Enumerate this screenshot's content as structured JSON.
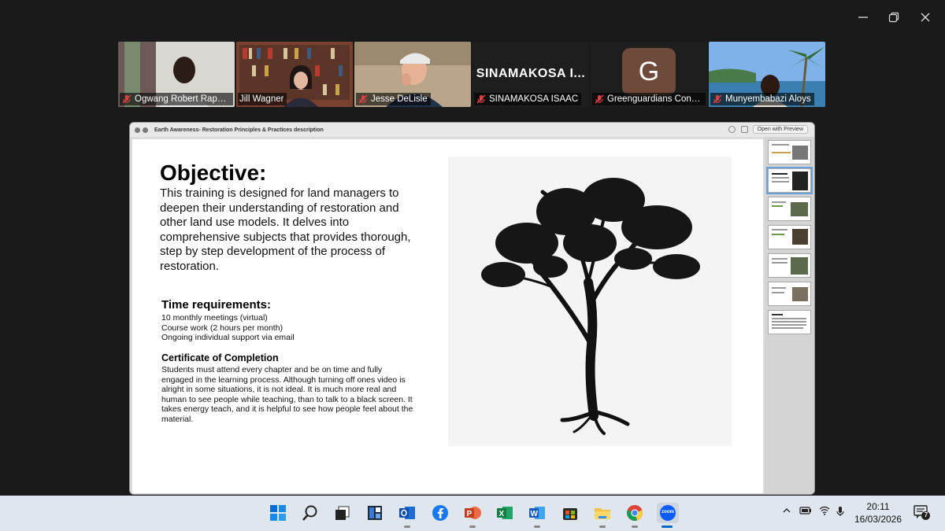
{
  "participants": [
    {
      "name": "Ogwang Robert Rapsy...",
      "muted": true
    },
    {
      "name": "Jill Wagner",
      "muted": false,
      "active_speaker": true
    },
    {
      "name": "Jesse DeLisle",
      "muted": true
    },
    {
      "name": "SINAMAKOSA ISAAC",
      "muted": true,
      "display_title": "SINAMAKOSA  I..."
    },
    {
      "name": "Greenguardians Cons...",
      "muted": true,
      "avatar_letter": "G"
    },
    {
      "name": "Munyembabazi Aloys",
      "muted": true
    }
  ],
  "shared_window": {
    "title": "Earth Awareness- Restoration Principles & Practices description",
    "open_with_label": "Open with Preview",
    "slide": {
      "heading": "Objective:",
      "objective": "This training is designed for land managers to deepen their understanding of restoration and other land use models.  It delves into comprehensive subjects that provides thorough, step by step development of the process of restoration.",
      "time_heading": "Time requirements:",
      "time_items": [
        "10 monthly meetings (virtual)",
        "Course work (2 hours per month)",
        "Ongoing individual support via email"
      ],
      "cert_heading": "Certificate of Completion",
      "cert_text": "Students must attend every chapter and be on time and fully engaged in the learning process.  Although turning off ones video is alright in some situations, it is not ideal.  It is much more real and human to see people while teaching, than to talk to a black screen.  It takes energy teach, and it is helpful to see how people feel about the material."
    },
    "thumbnail_count": 7,
    "selected_thumbnail": 2
  },
  "taskbar": {
    "apps": [
      "start-icon",
      "search-icon",
      "task-view-icon",
      "widgets-icon",
      "outlook-icon",
      "facebook-icon",
      "powerpoint-icon",
      "excel-icon",
      "word-icon",
      "store-icon",
      "file-explorer-icon",
      "chrome-icon",
      "zoom-icon"
    ],
    "zoom_label": "zoom",
    "time": "20:11",
    "date": "16/03/2026",
    "notification_count": "7"
  },
  "colors": {
    "active_speaker": "#2ecc40",
    "taskbar_bg": "#dfe6ee",
    "meeting_bg": "#1a1a1a"
  }
}
